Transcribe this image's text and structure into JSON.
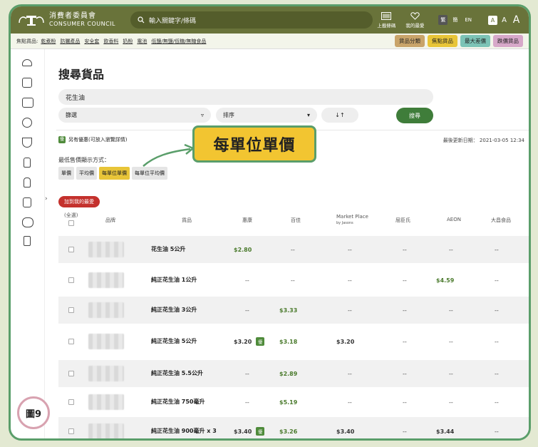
{
  "header": {
    "logo_zh": "消費者委員會",
    "logo_en": "CONSUMER COUNCIL",
    "search_placeholder": "輸入關鍵字/條碼",
    "upload_label": "上載條碼",
    "favorites_label": "我的最愛",
    "lang": [
      "繁",
      "簡",
      "EN"
    ],
    "font_sizes": [
      "A",
      "A",
      "A"
    ]
  },
  "subnav": {
    "label": "焦點貨品:",
    "tags": [
      "乾煮粉",
      "防曬產品",
      "安全套",
      "飲香料",
      "奶粉",
      "電池",
      "低鹽/無鹽/低糖/無糖食品"
    ],
    "buttons": [
      {
        "label": "貨品分類",
        "color": "#c9a46a"
      },
      {
        "label": "焦點貨品",
        "color": "#e8c538"
      },
      {
        "label": "最大差價",
        "color": "#7cc3b6"
      },
      {
        "label": "跌價貨品",
        "color": "#d7a8c9"
      }
    ]
  },
  "main": {
    "title": "搜尋貨品",
    "query": "花生油",
    "filter": "篩選",
    "sort": "排序",
    "sort_icon": "↓↑",
    "search_button": "搜尋",
    "offer_badge": "優",
    "offer_text": "另有優惠(可放入瀏覽詳情)",
    "updated": "最後更新日期： 2021-03-05 12:34",
    "callout": "每單位單價",
    "display_label": "最低售價顯示方式：",
    "display_tabs": [
      {
        "label": "單價",
        "active": false
      },
      {
        "label": "平均價",
        "active": false
      },
      {
        "label": "每單位單價",
        "active": true
      },
      {
        "label": "每單位平均價",
        "active": false
      }
    ],
    "add_fav": "加到我的最愛",
    "select_all": "(全選)"
  },
  "table": {
    "headers": [
      "品牌",
      "貨品",
      "惠康",
      "百佳",
      "Market Place",
      "屈臣氏",
      "AEON",
      "大昌食品"
    ],
    "header_sub": "by Jasons",
    "rows": [
      {
        "name": "花生油 5公升",
        "prices": [
          "$2.80",
          "--",
          "--",
          "--",
          "--",
          "--"
        ],
        "badge": false
      },
      {
        "name": "純正花生油 1公升",
        "prices": [
          "--",
          "--",
          "--",
          "--",
          "$4.59",
          "--"
        ],
        "badge": false
      },
      {
        "name": "純正花生油 3公升",
        "prices": [
          "--",
          "$3.33",
          "--",
          "--",
          "--",
          "--"
        ],
        "badge": false
      },
      {
        "name": "純正花生油 5公升",
        "prices": [
          "$3.20",
          "$3.18",
          "$3.20",
          "--",
          "--",
          "--"
        ],
        "badge": true
      },
      {
        "name": "純正花生油 5.5公升",
        "prices": [
          "--",
          "$2.89",
          "--",
          "--",
          "--",
          "--"
        ],
        "badge": false
      },
      {
        "name": "純正花生油 750毫升",
        "prices": [
          "--",
          "$5.19",
          "--",
          "--",
          "--",
          "--"
        ],
        "badge": false
      },
      {
        "name": "純正花生油 900毫升 x 3",
        "prices": [
          "$3.40",
          "$3.26",
          "$3.40",
          "--",
          "$3.44",
          "--"
        ],
        "badge": true
      }
    ]
  },
  "figure_label": "圖9"
}
